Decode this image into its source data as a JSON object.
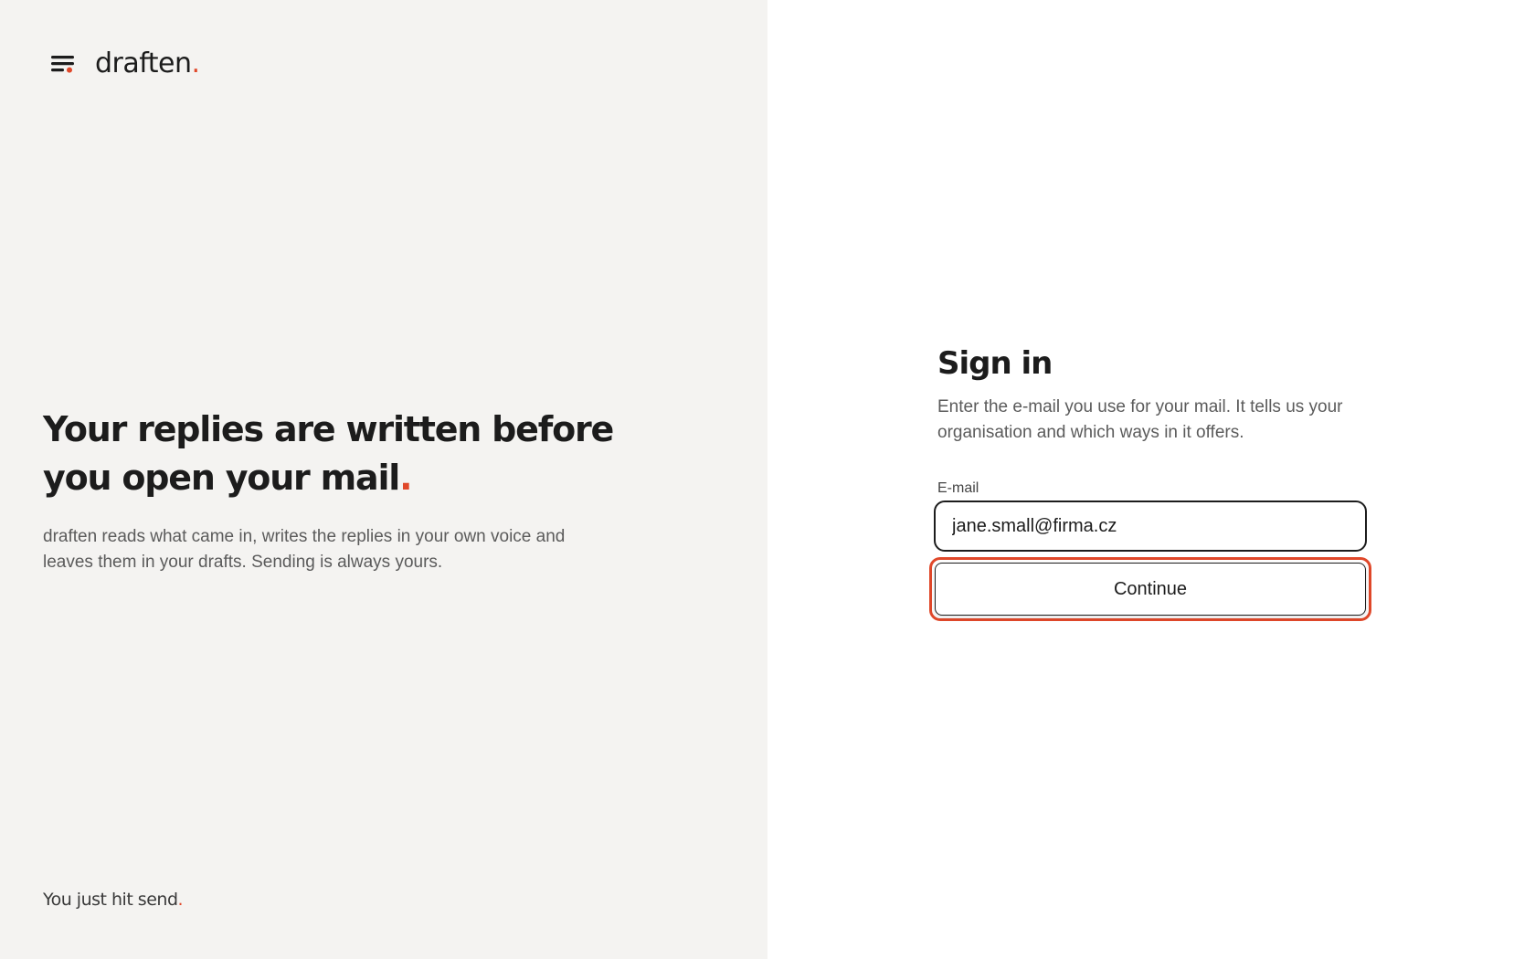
{
  "brand": {
    "name": "draften",
    "dot": ".",
    "accent_color": "#e0482a",
    "icon": "menu-lines-icon"
  },
  "hero": {
    "title_main": "Your replies are written before you open your mail",
    "title_dot": ".",
    "body": "draften reads what came in, writes the replies in your own voice and leaves them in your drafts. Sending is always yours."
  },
  "tagline": {
    "text": "You just hit send",
    "dot": "."
  },
  "signin": {
    "title": "Sign in",
    "subtitle": "Enter the e-mail you use for your mail. It tells us your organisation and which ways in it offers.",
    "email_label": "E-mail",
    "email_value": "jane.small@firma.cz",
    "continue_label": "Continue"
  },
  "colors": {
    "left_background": "#f4f3f1",
    "right_background": "#ffffff",
    "text": "#1c1c1c",
    "muted_text": "#5b5b5b",
    "focus_ring": "#e0482a"
  }
}
